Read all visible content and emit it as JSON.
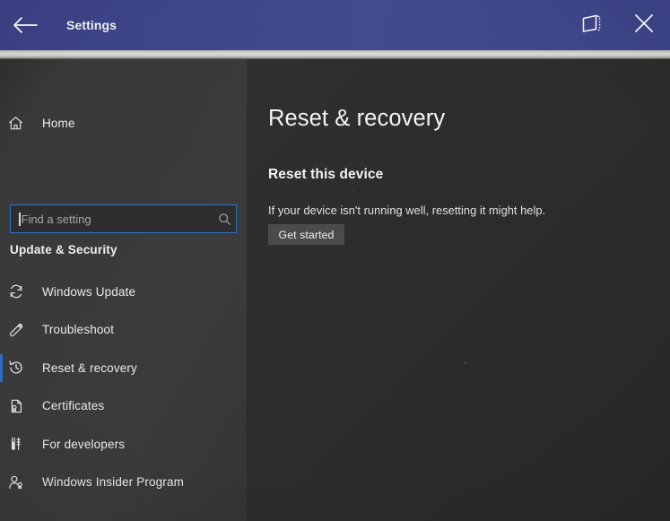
{
  "window": {
    "title": "Settings",
    "accent_blue": "#3f4586",
    "selection_blue": "#2b6fc4",
    "back_icon": "back-arrow-icon",
    "restore_icon": "restore-window-icon",
    "close_icon": "close-icon"
  },
  "sidebar": {
    "home": {
      "label": "Home",
      "icon": "home-icon"
    },
    "search": {
      "placeholder": "Find a setting",
      "value": "",
      "icon": "search-icon"
    },
    "group_title": "Update & Security",
    "items": [
      {
        "label": "Windows Update",
        "icon": "sync-icon",
        "selected": false
      },
      {
        "label": "Troubleshoot",
        "icon": "wrench-icon",
        "selected": false
      },
      {
        "label": "Reset & recovery",
        "icon": "history-clock-icon",
        "selected": true
      },
      {
        "label": "Certificates",
        "icon": "certificate-icon",
        "selected": false
      },
      {
        "label": "For developers",
        "icon": "developer-tools-icon",
        "selected": false
      },
      {
        "label": "Windows Insider Program",
        "icon": "user-badge-icon",
        "selected": false
      }
    ]
  },
  "main": {
    "page_title": "Reset & recovery",
    "section_title": "Reset this device",
    "section_description": "If your device isn't running well, resetting it might help.",
    "get_started_label": "Get started"
  }
}
